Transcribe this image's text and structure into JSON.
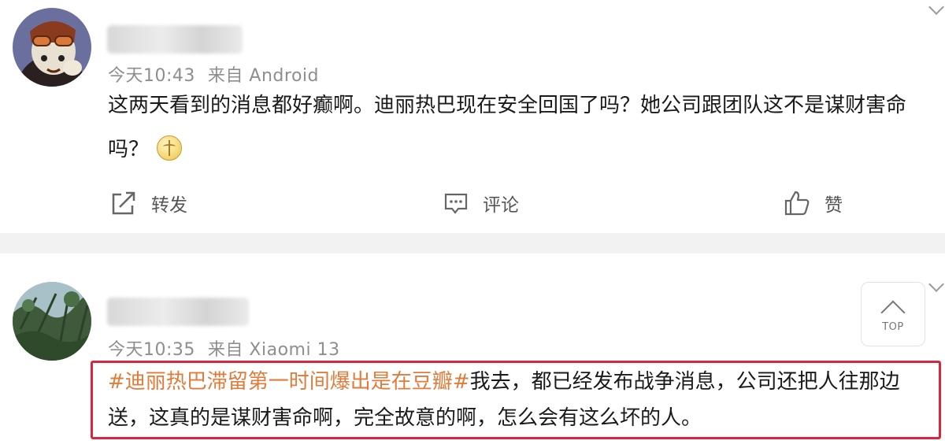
{
  "posts": [
    {
      "time": "今天10:43",
      "source_prefix": "来自",
      "source": "Android",
      "content": "这两天看到的消息都好癫啊。迪丽热巴现在安全回国了吗？她公司跟团队这不是谋财害命吗？",
      "actions": {
        "repost": "转发",
        "comment": "评论",
        "like": "赞"
      }
    },
    {
      "time": "今天10:35",
      "source_prefix": "来自",
      "source": "Xiaomi 13",
      "hashtag": "#迪丽热巴滞留第一时间爆出是在豆瓣#",
      "content": "我去，都已经发布战争消息，公司还把人往那边送，这真的是谋财害命啊，完全故意的啊，怎么会有这么坏的人。"
    }
  ],
  "top_button": {
    "label": "TOP"
  },
  "colors": {
    "hashtag": "#e07b3a",
    "highlight_box": "#d8263c",
    "meta_text": "#8e8e8e",
    "separator": "#f2f2f2"
  },
  "icons": [
    "repost-icon",
    "comment-icon",
    "like-icon",
    "chevron-down-icon",
    "arrow-up-icon",
    "emoji-icon"
  ]
}
